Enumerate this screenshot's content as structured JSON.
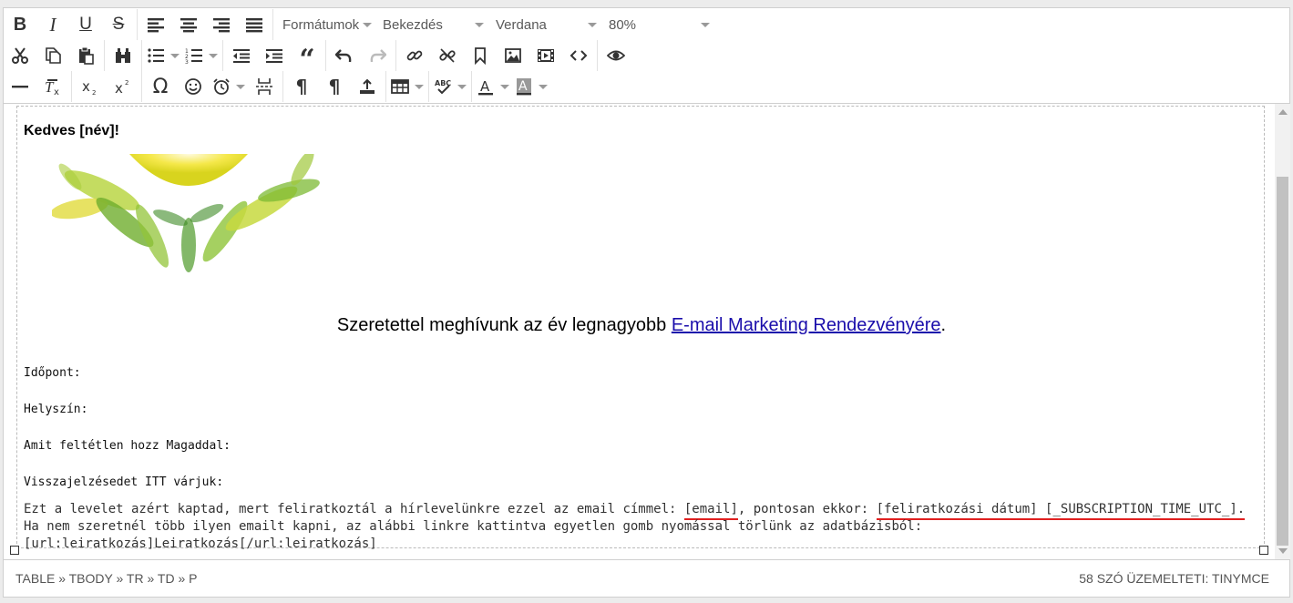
{
  "toolbar": {
    "formats_label": "Formátumok",
    "block_label": "Bekezdés",
    "font_label": "Verdana",
    "size_label": "80%"
  },
  "content": {
    "greeting": "Kedves [név]!",
    "invite_text": "Szeretettel meghívunk az év legnagyobb ",
    "invite_link": "E-mail Marketing Rendezvényére",
    "invite_end": ".",
    "field_time": "Időpont:",
    "field_place": "Helyszín:",
    "field_bring": "Amit feltétlen hozz Magaddal:",
    "field_reply": "Visszajelzésedet ITT várjuk:",
    "footer_part1": "Ezt a levelet azért kaptad, mert feliratkoztál a hírlevelünkre ezzel az email címmel: ",
    "footer_email_tag": "[email]",
    "footer_part2": ", pontosan ekkor: ",
    "footer_date_tag": "[feliratkozási dátum] [_SUBSCRIPTION_TIME_UTC_].",
    "footer_part3": " Ha nem szeretnél több ilyen emailt kapni, az alábbi linkre kattintva egyetlen gomb nyomással törlünk az adatbázisból: ",
    "footer_unsub_tag": "[url:leiratkozás]Leiratkozás[/url:leiratkozás]"
  },
  "statusbar": {
    "path": "TABLE » TBODY » TR » TD » P",
    "info": "58 SZÓ ÜZEMELTETI: TINYMCE"
  },
  "colors": {
    "link": "#1a0dab",
    "spell_underline": "#e02020"
  }
}
